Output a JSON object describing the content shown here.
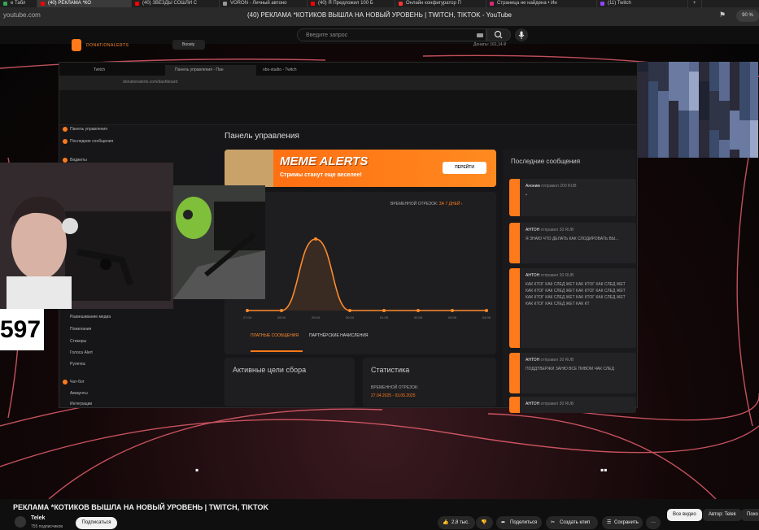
{
  "browser": {
    "tabs": [
      {
        "label": "е Табл",
        "color": "#34a853"
      },
      {
        "label": "(40) РЕКЛАМА *КО",
        "color": "#ff0000",
        "active": true
      },
      {
        "label": "(40) ЗВЕЗДЫ СОШЛИ С",
        "color": "#ff0000"
      },
      {
        "label": "VORON - Личный автоно",
        "color": "#999999"
      },
      {
        "label": "(40) Я Предложил 100 Б",
        "color": "#ff0000"
      },
      {
        "label": "Онлайн конфигуратор П",
        "color": "#ff3333"
      },
      {
        "label": "Страница не найдена • Ин",
        "color": "#d62976"
      },
      {
        "label": "(11) Twitch",
        "color": "#9146ff"
      }
    ],
    "new_tab": "+",
    "url": "youtube.com",
    "page_title": "(40) РЕКЛАМА *КОТИКОВ ВЫШЛА НА НОВЫЙ УРОВЕНЬ | TWITCH, TIKTOK - YouTube",
    "zoom": "90 %"
  },
  "youtube": {
    "search_placeholder": "Введите запрос",
    "video_title": "РЕКЛАМА *КОТИКОВ ВЫШЛА НА НОВЫЙ УРОВЕНЬ | TWITCH, TIKTOK",
    "channel": "Telek",
    "subscribers": "755 подписчиков",
    "subscribe": "Подписаться",
    "likes": "2,8 тыс.",
    "share": "Поделиться",
    "clip": "Создать клип",
    "save": "Сохранить",
    "more": "···",
    "chips": [
      "Все видео",
      "Автор: Telek",
      "Похо"
    ]
  },
  "stream": {
    "tabs": [
      "Twitch",
      "Панель управления - Пан",
      "obs-studio - Twitch"
    ],
    "url": "donationalerts.com/dashboard",
    "logo": "DONATIONALERTS",
    "boosty": "Boosty",
    "donated": "Донаты: 161,14 ₽",
    "sidebar": {
      "top": [
        "Панель управления",
        "Последние сообщения"
      ],
      "mid": "Виджеты",
      "list": [
        "Развешивание медиа",
        "Пожелания",
        "Стикеры",
        "Голоса Alert",
        "Рулетка"
      ],
      "chat": "Чат-бот",
      "chat_list": [
        "Аккаунты",
        "Интеграции"
      ]
    },
    "panel_title": "Панель управления",
    "banner_title": "MEME ALERTS",
    "banner_sub": "Стримы станут еще веселее!",
    "banner_btn": "ПЕРЕЙТИ",
    "period_label": "ВРЕМЕННОЙ ОТРЕЗОК:",
    "period_value": "ЗА 7 ДНЕЙ ›",
    "chart_letter": "а",
    "chart_tab1": "ПЛАТНЫЕ СООБЩЕНИЯ",
    "chart_tab2": "ПАРТНЁРСКИЕ НАЧИСЛЕНИЯ",
    "goals_title": "Активные цели сбора",
    "stats_title": "Статистика",
    "stats_sub": "ВРЕМЕННОЙ ОТРЕЗОК:",
    "stats_dates": "27.04.2025 - 03.05.2025",
    "messages_title": "Последние сообщения",
    "messages": [
      {
        "name": "Аноним",
        "meta": "отправил 200 RUB",
        "text": "▪"
      },
      {
        "name": "АНТОН",
        "meta": "отправил 30 RUB",
        "text": "Я ЗНАЮ ЧТО ДЕЛАТЬ КАК СЛОДИРОВАТЬ ВЫ..."
      },
      {
        "name": "АНТОН",
        "meta": "отправил 30 RUB",
        "text": "КАК КТОГ КАК СЛЕД ЖЕТ КАК КТОГ КАК СЛЕД ЖЕТ КАК КТОГ КАК СЛЕД ЖЕТ КАК КТОГ КАК СЛЕД ЖЕТ КАК КТОГ КАК СЛЕД ЖЕТ КАК КТОГ КАК СЛЕД ЖЕТ КАК КТОГ КАК СЛЕД ЖЕТ КАК КТ"
      },
      {
        "name": "АНТОН",
        "meta": "отправил 30 RUB",
        "text": "ПОДДТВЕРЖИ ЗАНЮ ВСЕ ПИВОМ ЧАК СЛЕД"
      },
      {
        "name": "АНТОН",
        "meta": "отправил 30 RUB",
        "text": ""
      }
    ],
    "counter": "597"
  },
  "chart_data": {
    "type": "line",
    "x": [
      "27.04",
      "28.04",
      "29.04",
      "30.04",
      "01.05",
      "02.05",
      "03.05",
      "04.05"
    ],
    "y": [
      0,
      0,
      1,
      0,
      0,
      0,
      0,
      0
    ],
    "y_tick_label": "0 RUB",
    "peak_note": "single spike",
    "color": "#ff8c2e"
  },
  "colors": {
    "accent": "#ff7a1a",
    "yt_bg": "#0f0f0f"
  }
}
